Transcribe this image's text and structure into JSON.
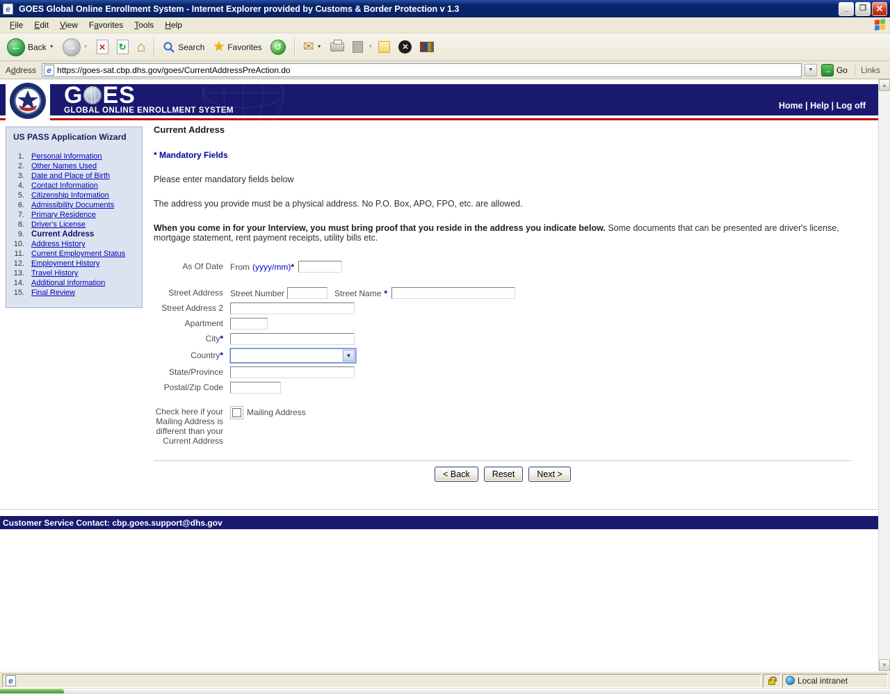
{
  "window": {
    "title": "GOES Global Online Enrollment System - Internet Explorer provided by Customs & Border Protection v 1.3"
  },
  "menu": {
    "items": [
      {
        "pre": "",
        "accel": "F",
        "post": "ile"
      },
      {
        "pre": "",
        "accel": "E",
        "post": "dit"
      },
      {
        "pre": "",
        "accel": "V",
        "post": "iew"
      },
      {
        "pre": "F",
        "accel": "a",
        "post": "vorites"
      },
      {
        "pre": "",
        "accel": "T",
        "post": "ools"
      },
      {
        "pre": "",
        "accel": "H",
        "post": "elp"
      }
    ]
  },
  "toolbar": {
    "back_label": "Back",
    "search_label": "Search",
    "favorites_label": "Favorites"
  },
  "address_bar": {
    "label_pre": "A",
    "label_accel": "d",
    "label_post": "dress",
    "url": "https://goes-sat.cbp.dhs.gov/goes/CurrentAddressPreAction.do",
    "go_label": "Go",
    "links_label": "Links"
  },
  "header": {
    "logo_g": "G",
    "logo_es": "ES",
    "logo_subtitle": "GLOBAL ONLINE ENROLLMENT SYSTEM",
    "nav": "Home | Help | Log off"
  },
  "sidebar": {
    "title": "US PASS Application Wizard",
    "items": [
      {
        "num": "1.",
        "label": "Personal Information"
      },
      {
        "num": "2.",
        "label": "Other Names Used"
      },
      {
        "num": "3.",
        "label": "Date and Place of Birth"
      },
      {
        "num": "4.",
        "label": "Contact Information"
      },
      {
        "num": "5.",
        "label": "Citizenship Information"
      },
      {
        "num": "6.",
        "label": "Admissibility Documents"
      },
      {
        "num": "7.",
        "label": "Primary Residence"
      },
      {
        "num": "8.",
        "label": "Driver's License"
      },
      {
        "num": "9.",
        "label": "Current Address"
      },
      {
        "num": "10.",
        "label": "Address History"
      },
      {
        "num": "11.",
        "label": "Current Employment Status"
      },
      {
        "num": "12.",
        "label": "Employment History"
      },
      {
        "num": "13.",
        "label": "Travel History"
      },
      {
        "num": "14.",
        "label": "Additional Information"
      },
      {
        "num": "15.",
        "label": "Final Review"
      }
    ]
  },
  "main": {
    "heading": "Current Address",
    "mandatory_note": "* Mandatory Fields",
    "instruction1": "Please enter mandatory fields below",
    "instruction2": "The address you provide must be a physical address. No P.O. Box, APO, FPO, etc. are allowed.",
    "interview_bold": "When you come in for your Interview, you must bring proof that you reside in the address you indicate below.",
    "interview_rest": " Some documents that can be presented are driver's license, mortgage statement, rent payment receipts, utility bills etc.",
    "form": {
      "as_of_date_label": "As Of Date",
      "from_label": "From",
      "from_format": "(yyyy/mm)",
      "star": "*",
      "street_address_label": "Street Address",
      "street_number_label": "Street Number",
      "street_name_label": "Street Name",
      "street_address2_label": "Street Address 2",
      "apartment_label": "Apartment",
      "city_label": "City",
      "country_label": "Country",
      "state_label": "State/Province",
      "postal_label": "Postal/Zip Code",
      "mailing_check_label": "Check here if your Mailing Address is different than your Current Address",
      "mailing_checkbox_text": "Mailing Address"
    },
    "buttons": {
      "back": "< Back",
      "reset": "Reset",
      "next": "Next >"
    }
  },
  "footer": {
    "text": "Customer Service Contact: cbp.goes.support@dhs.gov"
  },
  "status_bar": {
    "zone": "Local intranet"
  }
}
